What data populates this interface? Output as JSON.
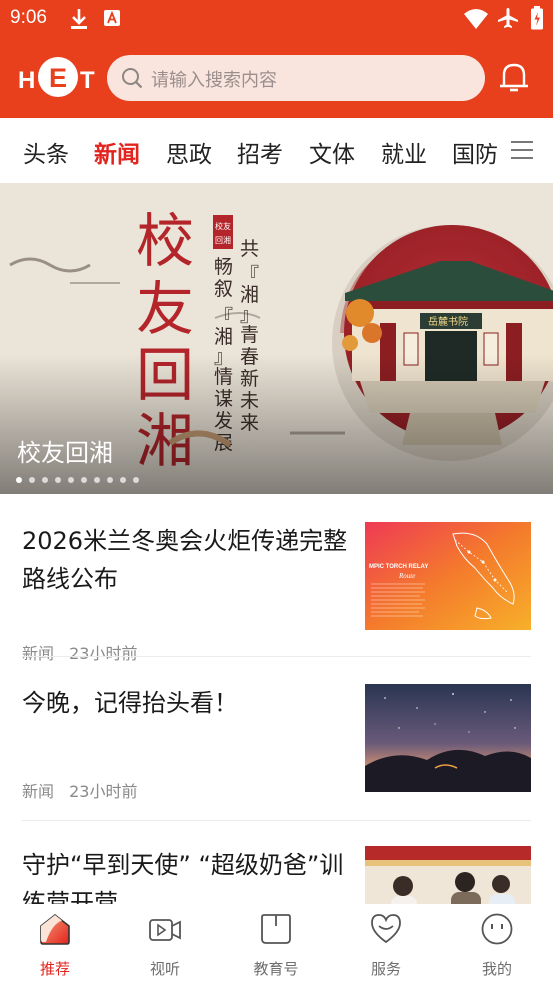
{
  "status_bar": {
    "time": "9:06"
  },
  "header": {
    "logo_text": "HET",
    "search_placeholder": "请输入搜索内容"
  },
  "tabs": [
    {
      "label": "头条"
    },
    {
      "label": "新闻",
      "active": true
    },
    {
      "label": "思政"
    },
    {
      "label": "招考"
    },
    {
      "label": "文体"
    },
    {
      "label": "就业"
    },
    {
      "label": "国防"
    }
  ],
  "banner": {
    "caption": "校友回湘",
    "slide_count": 10,
    "active_slide": 1,
    "art_text": {
      "big": [
        "校",
        "友",
        "回",
        "湘"
      ],
      "seal": "校友回湘",
      "col1": "共『湘』青春",
      "col2": "畅叙『湘』情",
      "col3": "新未来",
      "col4": "谋发展",
      "gate": "岳麓书院"
    }
  },
  "news": [
    {
      "title": "2026米兰冬奥会火炬传递完整路线公布",
      "category": "新闻",
      "time": "23小时前",
      "thumb_text": "MPIC TORCH RELAY Route"
    },
    {
      "title": "今晚，记得抬头看！",
      "category": "新闻",
      "time": "23小时前"
    },
    {
      "title": "守护“早到天使” “超级奶爸”训练营开营",
      "category": "",
      "time": ""
    }
  ],
  "bottom_nav": [
    {
      "label": "推荐",
      "icon": "home-icon",
      "active": true
    },
    {
      "label": "视听",
      "icon": "video-icon"
    },
    {
      "label": "教育号",
      "icon": "book-icon"
    },
    {
      "label": "服务",
      "icon": "heart-icon"
    },
    {
      "label": "我的",
      "icon": "profile-icon"
    }
  ],
  "colors": {
    "brand": "#e8401c",
    "active": "#e3231e",
    "search_bg": "#f9e5de"
  }
}
